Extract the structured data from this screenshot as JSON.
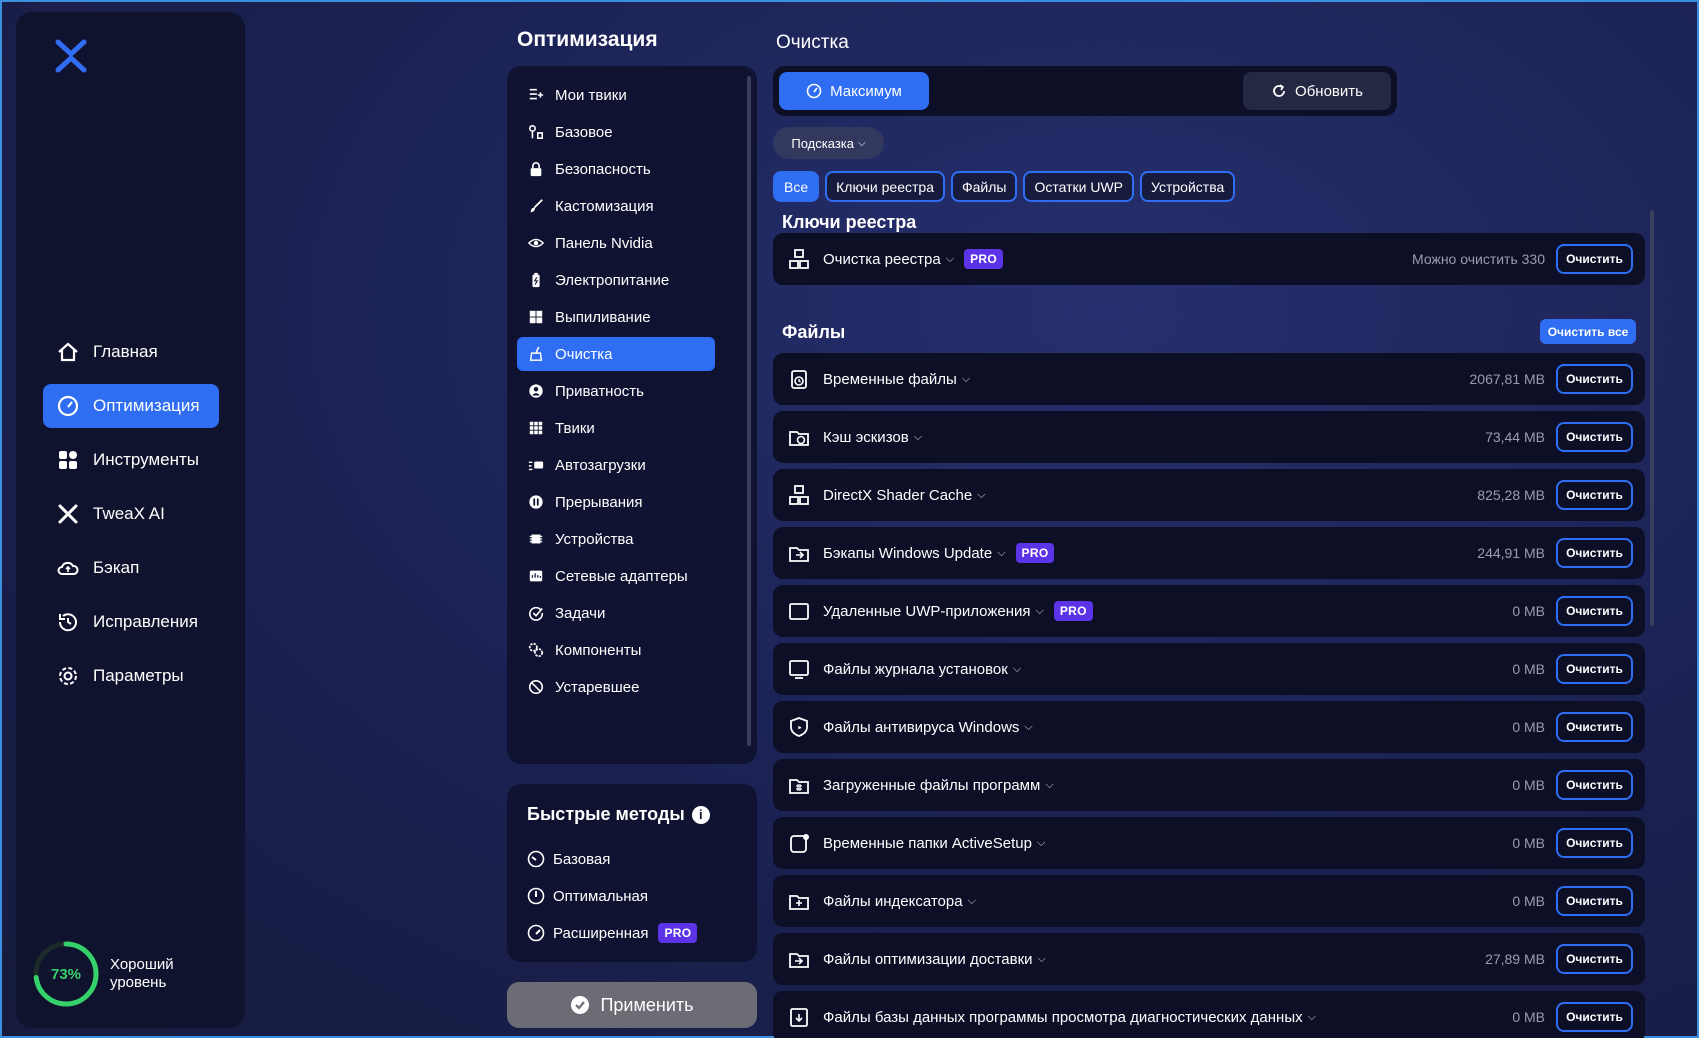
{
  "sidebar": {
    "items": [
      {
        "label": "Главная",
        "icon": "home-icon",
        "active": false
      },
      {
        "label": "Оптимизация",
        "icon": "gauge-icon",
        "active": true
      },
      {
        "label": "Инструменты",
        "icon": "grid-icon",
        "active": false
      },
      {
        "label": "TweaX AI",
        "icon": "ai-icon",
        "active": false
      },
      {
        "label": "Бэкап",
        "icon": "cloud-backup-icon",
        "active": false
      },
      {
        "label": "Исправления",
        "icon": "history-icon",
        "active": false
      },
      {
        "label": "Параметры",
        "icon": "gear-icon",
        "active": false
      }
    ],
    "score": {
      "value": "73%",
      "percent": 73,
      "label_line1": "Хороший",
      "label_line2": "уровень",
      "color": "#36d16a"
    }
  },
  "middle": {
    "title": "Оптимизация",
    "menu": [
      {
        "label": "Мои твики",
        "icon": "list-add-icon"
      },
      {
        "label": "Базовое",
        "icon": "tools-icon"
      },
      {
        "label": "Безопасность",
        "icon": "lock-icon"
      },
      {
        "label": "Кастомизация",
        "icon": "brush-icon"
      },
      {
        "label": "Панель Nvidia",
        "icon": "nvidia-eye-icon"
      },
      {
        "label": "Электропитание",
        "icon": "battery-icon"
      },
      {
        "label": "Выпиливание",
        "icon": "windows-icon"
      },
      {
        "label": "Очистка",
        "icon": "broom-icon",
        "active": true
      },
      {
        "label": "Приватность",
        "icon": "privacy-icon"
      },
      {
        "label": "Твики",
        "icon": "dots-grid-icon"
      },
      {
        "label": "Автозагрузки",
        "icon": "startup-icon"
      },
      {
        "label": "Прерывания",
        "icon": "interrupt-icon"
      },
      {
        "label": "Устройства",
        "icon": "chip-icon"
      },
      {
        "label": "Сетевые адаптеры",
        "icon": "network-icon"
      },
      {
        "label": "Задачи",
        "icon": "task-icon"
      },
      {
        "label": "Компоненты",
        "icon": "components-icon"
      },
      {
        "label": "Устаревшее",
        "icon": "deprecated-icon"
      }
    ],
    "quick": {
      "title": "Быстрые методы",
      "info": "i",
      "items": [
        {
          "label": "Базовая",
          "icon": "speed-low-icon",
          "pro": false
        },
        {
          "label": "Оптимальная",
          "icon": "speed-mid-icon",
          "pro": false
        },
        {
          "label": "Расширенная",
          "icon": "speed-high-icon",
          "pro": true
        }
      ]
    },
    "apply_label": "Применить"
  },
  "right": {
    "title": "Очистка",
    "max_label": "Максимум",
    "refresh_label": "Обновить",
    "hint_label": "Подсказка",
    "filters": [
      {
        "label": "Все",
        "active": true
      },
      {
        "label": "Ключи реестра",
        "active": false
      },
      {
        "label": "Файлы",
        "active": false
      },
      {
        "label": "Остатки UWP",
        "active": false
      },
      {
        "label": "Устройства",
        "active": false
      }
    ],
    "pro_label": "PRO",
    "clean_label": "Очистить",
    "registry_title": "Ключи реестра",
    "registry_row": {
      "label": "Очистка реестра",
      "pro": true,
      "status": "Можно очистить 330",
      "icon": "registry-icon"
    },
    "files_title": "Файлы",
    "clean_all_label": "Очистить все",
    "files": [
      {
        "label": "Временные файлы",
        "size": "2067,81 MB",
        "pro": false,
        "icon": "temp-files-icon"
      },
      {
        "label": "Кэш эскизов",
        "size": "73,44 MB",
        "pro": false,
        "icon": "thumbnail-cache-icon"
      },
      {
        "label": "DirectX Shader Cache",
        "size": "825,28 MB",
        "pro": false,
        "icon": "directx-icon"
      },
      {
        "label": "Бэкапы Windows Update",
        "size": "244,91 MB",
        "pro": true,
        "icon": "update-backup-icon"
      },
      {
        "label": "Удаленные UWP-приложения",
        "size": "0 MB",
        "pro": true,
        "icon": "uwp-icon"
      },
      {
        "label": "Файлы журнала установок",
        "size": "0 MB",
        "pro": false,
        "icon": "install-log-icon"
      },
      {
        "label": "Файлы антивируса Windows",
        "size": "0 MB",
        "pro": false,
        "icon": "antivirus-icon"
      },
      {
        "label": "Загруженные файлы программ",
        "size": "0 MB",
        "pro": false,
        "icon": "downloaded-programs-icon"
      },
      {
        "label": "Временные папки ActiveSetup",
        "size": "0 MB",
        "pro": false,
        "icon": "activesetup-icon"
      },
      {
        "label": "Файлы индексатора",
        "size": "0 MB",
        "pro": false,
        "icon": "indexer-icon"
      },
      {
        "label": "Файлы оптимизации доставки",
        "size": "27,89 MB",
        "pro": false,
        "icon": "delivery-optimization-icon"
      },
      {
        "label": "Файлы базы данных программы просмотра диагностических данных",
        "size": "0 MB",
        "pro": false,
        "icon": "diagnostics-db-icon"
      }
    ]
  },
  "colors": {
    "accent": "#2f6df2",
    "pro": "#5b34e8",
    "panel": "#0f1230",
    "good": "#36d16a"
  }
}
